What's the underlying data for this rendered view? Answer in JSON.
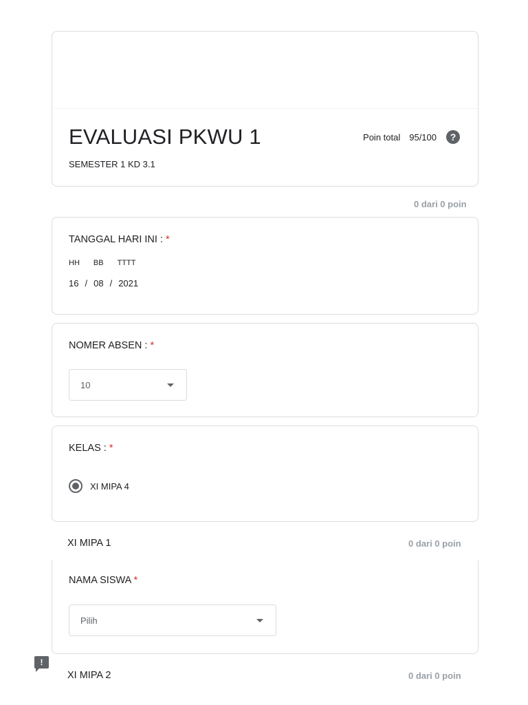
{
  "header": {
    "title": "EVALUASI PKWU 1",
    "description": "SEMESTER 1 KD 3.1",
    "points_label": "Poin total",
    "points_value": "95/100"
  },
  "sections": [
    {
      "points": "0 dari 0 poin"
    },
    {
      "title": "XI MIPA 1",
      "points": "0 dari 0 poin"
    },
    {
      "title": "XI MIPA 2",
      "points": "0 dari 0 poin"
    }
  ],
  "questions": {
    "date": {
      "title": "TANGGAL HARI INI :",
      "required_mark": "*",
      "labels": {
        "day": "HH",
        "month": "BB",
        "year": "TTTT"
      },
      "values": {
        "day": "16",
        "month": "08",
        "year": "2021"
      },
      "separator": "/"
    },
    "absen": {
      "title": "NOMER ABSEN :",
      "required_mark": "*",
      "selected": "10"
    },
    "kelas": {
      "title": "KELAS :",
      "required_mark": "*",
      "options": [
        "XI MIPA 4"
      ]
    },
    "nama": {
      "title": "NAMA SISWA",
      "required_mark": "*",
      "selected": "Pilih"
    }
  },
  "icons": {
    "help": "help-circle-icon",
    "dropdown": "caret-down-icon",
    "feedback": "feedback-icon"
  },
  "colors": {
    "required": "#d93025",
    "border": "#dadce0",
    "muted": "#9aa0a6"
  }
}
